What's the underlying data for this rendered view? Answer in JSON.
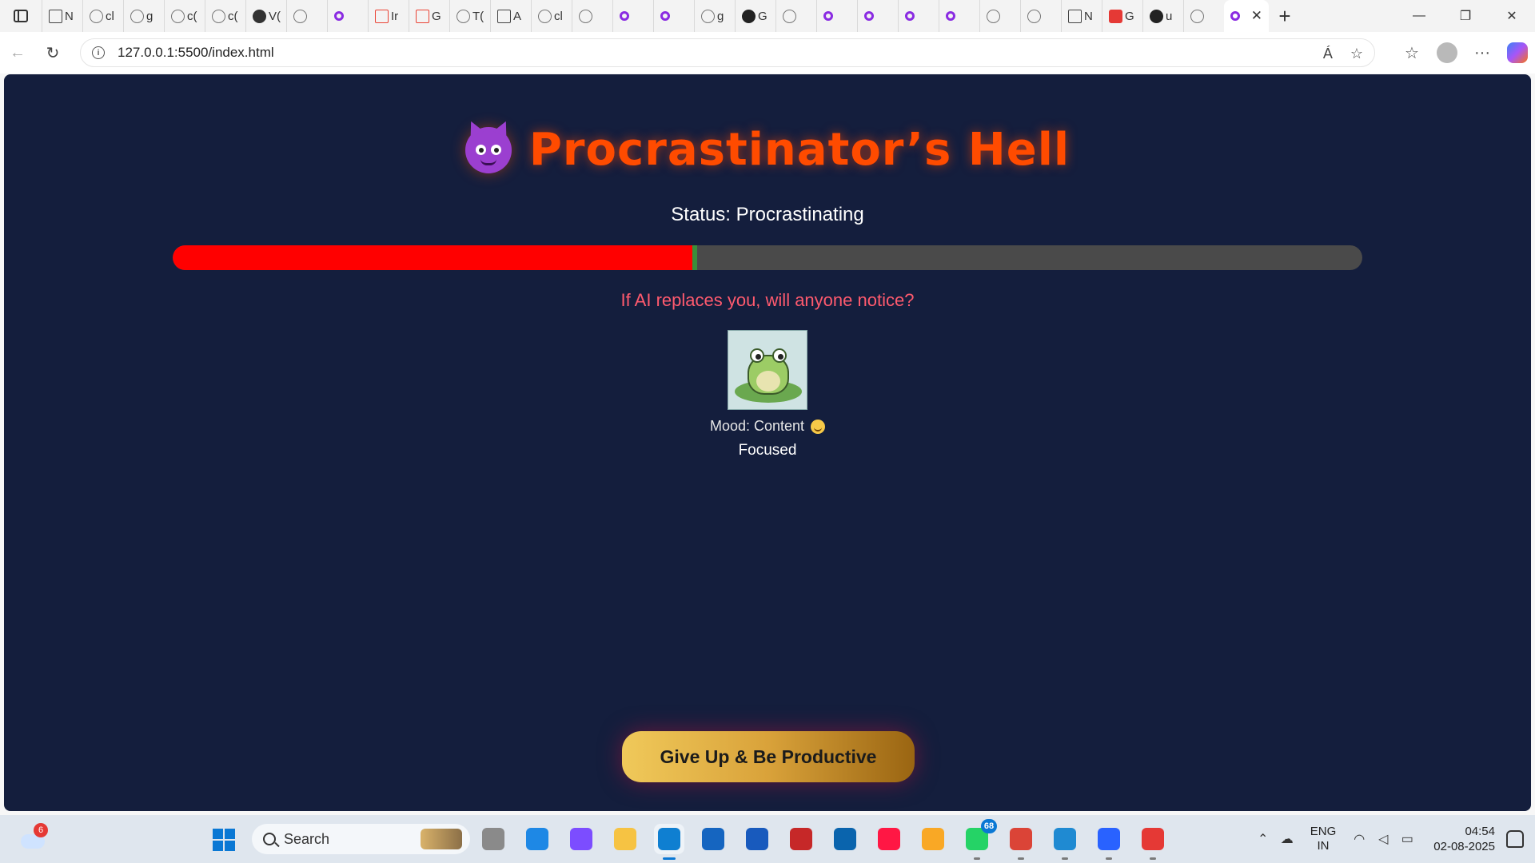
{
  "browser": {
    "tabs": [
      {
        "icon": "page-icon",
        "letter": "N"
      },
      {
        "icon": "globe-icon",
        "letter": "cl"
      },
      {
        "icon": "globe-icon",
        "letter": "g"
      },
      {
        "icon": "globe-icon",
        "letter": "c("
      },
      {
        "icon": "globe-icon",
        "letter": "c("
      },
      {
        "icon": "triangle-icon",
        "letter": "V("
      },
      {
        "icon": "globe-icon",
        "letter": ""
      },
      {
        "icon": "quill-icon",
        "letter": ""
      },
      {
        "icon": "mail-icon",
        "letter": "Ir"
      },
      {
        "icon": "mail-icon",
        "letter": "G"
      },
      {
        "icon": "rainbow-icon",
        "letter": "T("
      },
      {
        "icon": "font-icon",
        "letter": "A"
      },
      {
        "icon": "globe-icon",
        "letter": "cl"
      },
      {
        "icon": "globe-icon",
        "letter": ""
      },
      {
        "icon": "quill-icon",
        "letter": ""
      },
      {
        "icon": "quill-icon",
        "letter": ""
      },
      {
        "icon": "search-icon",
        "letter": "g"
      },
      {
        "icon": "github-icon",
        "letter": "G"
      },
      {
        "icon": "globe-icon",
        "letter": ""
      },
      {
        "icon": "quill-icon",
        "letter": ""
      },
      {
        "icon": "quill-icon",
        "letter": ""
      },
      {
        "icon": "quill-icon",
        "letter": ""
      },
      {
        "icon": "quill-icon",
        "letter": ""
      },
      {
        "icon": "globe-icon",
        "letter": ""
      },
      {
        "icon": "globe-icon",
        "letter": ""
      },
      {
        "icon": "calendar-icon",
        "letter": "N"
      },
      {
        "icon": "red-app-icon",
        "letter": "G"
      },
      {
        "icon": "github-icon",
        "letter": "u"
      },
      {
        "icon": "globe-icon",
        "letter": ""
      }
    ],
    "active_tab_close": "✕",
    "new_tab": "+",
    "window_controls": {
      "minimize": "—",
      "maximize": "❐",
      "close": "✕"
    },
    "url": "127.0.0.1:5500/index.html",
    "read_aloud": "Á",
    "favorite": "☆",
    "favorites_menu": "☆",
    "more": "···"
  },
  "page": {
    "title": "Procrastinator’s Hell",
    "status_text": "Status: Procrastinating",
    "progress": 0.437,
    "quote": "If AI replaces you, will anyone notice?",
    "mood_text": "Mood: Content",
    "focus_text": "Focused",
    "give_up_button": "Give Up & Be Productive",
    "colors": {
      "background": "#141e3d",
      "title": "#ff4b00",
      "progress_fill": "#ff0000",
      "progress_track": "#4a4a4a",
      "quote": "#ff5a6e"
    }
  },
  "taskbar": {
    "weather_badge": "6",
    "search_placeholder": "Search",
    "apps": [
      {
        "name": "task-view-icon"
      },
      {
        "name": "help-icon"
      },
      {
        "name": "copilot-icon"
      },
      {
        "name": "file-explorer-icon"
      },
      {
        "name": "edge-icon"
      },
      {
        "name": "store-icon"
      },
      {
        "name": "word-icon"
      },
      {
        "name": "mcafee-icon"
      },
      {
        "name": "outlook-icon"
      },
      {
        "name": "git-icon"
      },
      {
        "name": "notes-icon"
      },
      {
        "name": "whatsapp-icon",
        "badge": "68"
      },
      {
        "name": "chrome-icon"
      },
      {
        "name": "vscode-icon"
      },
      {
        "name": "notepad-icon"
      },
      {
        "name": "snipping-icon"
      }
    ],
    "lang_line1": "ENG",
    "lang_line2": "IN",
    "time": "04:54",
    "date": "02-08-2025"
  }
}
